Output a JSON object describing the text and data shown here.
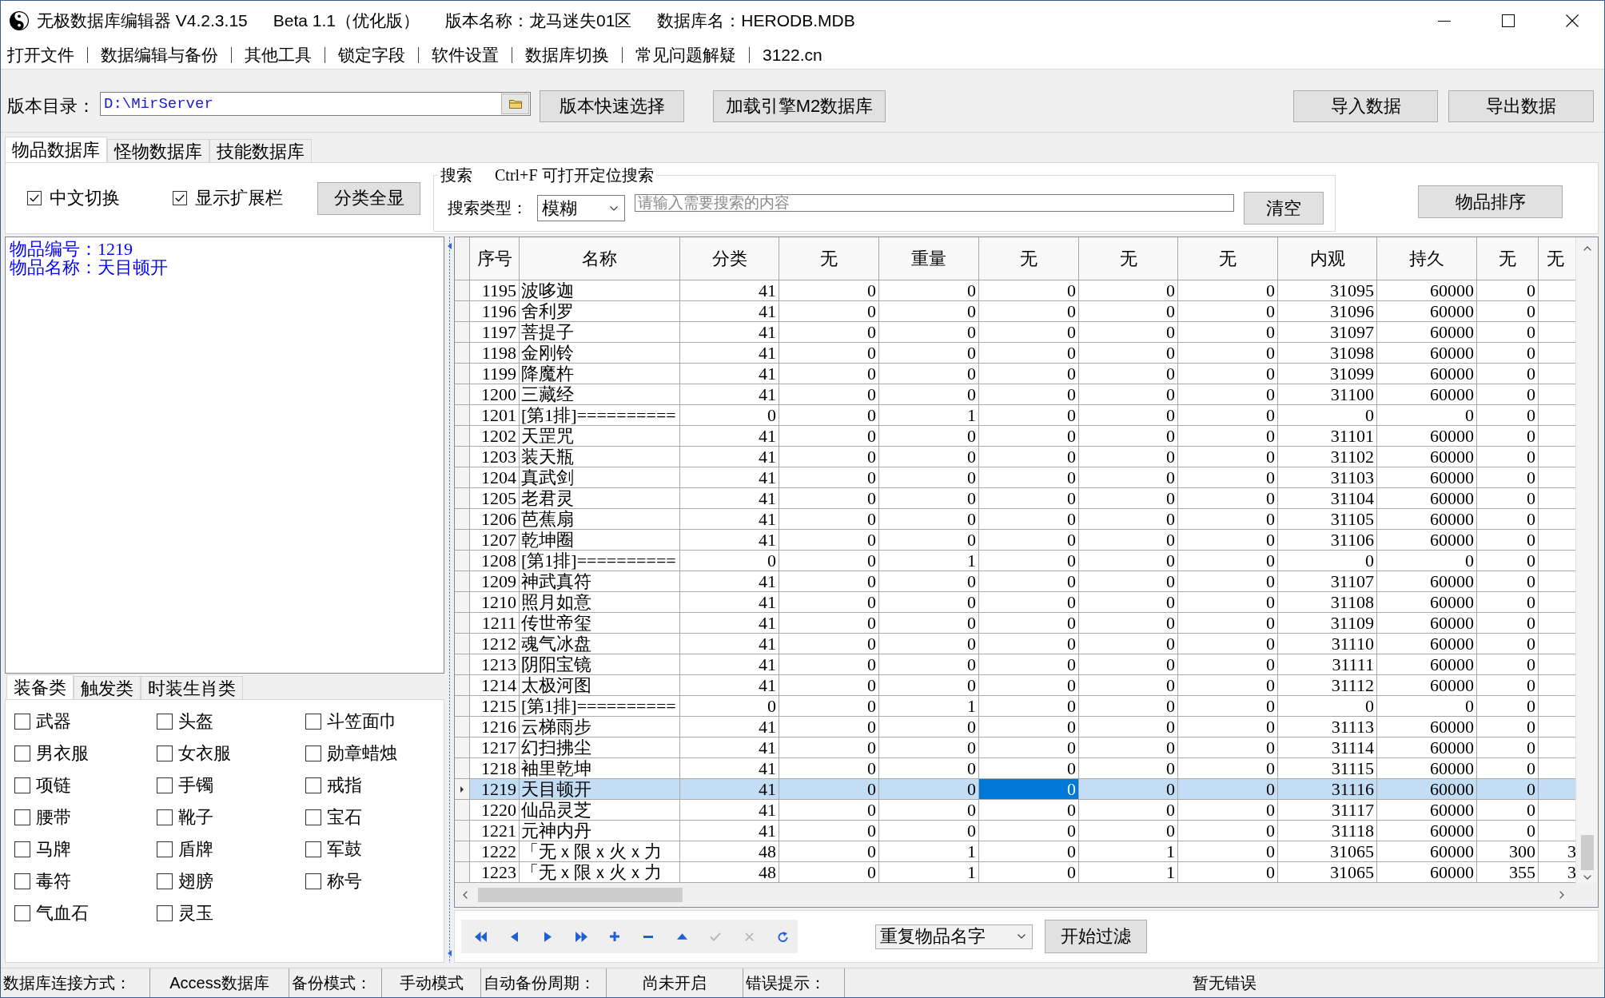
{
  "window": {
    "title_segments": [
      "无极数据库编辑器 V4.2.3.15",
      "Beta 1.1（优化版）",
      "版本名称：龙马迷失01区",
      "数据库名：HERODB.MDB"
    ]
  },
  "menu": [
    "打开文件",
    "数据编辑与备份",
    "其他工具",
    "锁定字段",
    "软件设置",
    "数据库切换",
    "常见问题解疑",
    "3122.cn"
  ],
  "toolbar": {
    "path_label": "版本目录：",
    "path_value": "D:\\MirServer",
    "buttons": [
      "版本快速选择",
      "加载引擎M2数据库"
    ],
    "right_buttons": [
      "导入数据",
      "导出数据"
    ]
  },
  "tabs": [
    {
      "label": "物品数据库",
      "selected": true
    },
    {
      "label": "怪物数据库",
      "selected": false
    },
    {
      "label": "技能数据库",
      "selected": false
    }
  ],
  "options": {
    "checkboxes": [
      {
        "label": "中文切换",
        "checked": true
      },
      {
        "label": "显示扩展栏",
        "checked": true
      }
    ],
    "show_all_button": "分类全显",
    "search": {
      "title": "搜索",
      "hint": "Ctrl+F 可打开定位搜索",
      "type_label": "搜索类型：",
      "type_value": "模糊",
      "placeholder": "请输入需要搜索的内容",
      "clear_button": "清空"
    },
    "sort_button": "物品排序"
  },
  "details": {
    "lines": [
      "物品编号：1219",
      "物品名称：天目顿开"
    ]
  },
  "category_tabs": [
    {
      "label": "装备类",
      "selected": true
    },
    {
      "label": "触发类",
      "selected": false
    },
    {
      "label": "时装生肖类",
      "selected": false
    }
  ],
  "categories": [
    {
      "label": "武器",
      "checked": false
    },
    {
      "label": "头盔",
      "checked": false
    },
    {
      "label": "斗笠面巾",
      "checked": false
    },
    {
      "label": "男衣服",
      "checked": false
    },
    {
      "label": "女衣服",
      "checked": false
    },
    {
      "label": "勋章蜡烛",
      "checked": false
    },
    {
      "label": "项链",
      "checked": false
    },
    {
      "label": "手镯",
      "checked": false
    },
    {
      "label": "戒指",
      "checked": false
    },
    {
      "label": "腰带",
      "checked": false
    },
    {
      "label": "靴子",
      "checked": false
    },
    {
      "label": "宝石",
      "checked": false
    },
    {
      "label": "马牌",
      "checked": false
    },
    {
      "label": "盾牌",
      "checked": false
    },
    {
      "label": "军鼓",
      "checked": false
    },
    {
      "label": "毒符",
      "checked": false
    },
    {
      "label": "翅膀",
      "checked": false
    },
    {
      "label": "称号",
      "checked": false
    },
    {
      "label": "气血石",
      "checked": false
    },
    {
      "label": "灵玉",
      "checked": false
    }
  ],
  "table": {
    "columns": [
      "序号",
      "名称",
      "分类",
      "无",
      "重量",
      "无",
      "无",
      "无",
      "内观",
      "持久",
      "无",
      "无"
    ],
    "rows": [
      {
        "cells": [
          "1195",
          "波哆迦",
          "41",
          "0",
          "0",
          "0",
          "0",
          "0",
          "31095",
          "60000",
          "0"
        ],
        "selected": false
      },
      {
        "cells": [
          "1196",
          "舍利罗",
          "41",
          "0",
          "0",
          "0",
          "0",
          "0",
          "31096",
          "60000",
          "0"
        ],
        "selected": false
      },
      {
        "cells": [
          "1197",
          "菩提子",
          "41",
          "0",
          "0",
          "0",
          "0",
          "0",
          "31097",
          "60000",
          "0"
        ],
        "selected": false
      },
      {
        "cells": [
          "1198",
          "金刚铃",
          "41",
          "0",
          "0",
          "0",
          "0",
          "0",
          "31098",
          "60000",
          "0"
        ],
        "selected": false
      },
      {
        "cells": [
          "1199",
          "降魔杵",
          "41",
          "0",
          "0",
          "0",
          "0",
          "0",
          "31099",
          "60000",
          "0"
        ],
        "selected": false
      },
      {
        "cells": [
          "1200",
          "三藏经",
          "41",
          "0",
          "0",
          "0",
          "0",
          "0",
          "31100",
          "60000",
          "0"
        ],
        "selected": false
      },
      {
        "cells": [
          "1201",
          "[第1排]==========",
          "0",
          "0",
          "1",
          "0",
          "0",
          "0",
          "0",
          "0",
          "0"
        ],
        "selected": false
      },
      {
        "cells": [
          "1202",
          "天罡咒",
          "41",
          "0",
          "0",
          "0",
          "0",
          "0",
          "31101",
          "60000",
          "0"
        ],
        "selected": false
      },
      {
        "cells": [
          "1203",
          "装天瓶",
          "41",
          "0",
          "0",
          "0",
          "0",
          "0",
          "31102",
          "60000",
          "0"
        ],
        "selected": false
      },
      {
        "cells": [
          "1204",
          "真武剑",
          "41",
          "0",
          "0",
          "0",
          "0",
          "0",
          "31103",
          "60000",
          "0"
        ],
        "selected": false
      },
      {
        "cells": [
          "1205",
          "老君灵",
          "41",
          "0",
          "0",
          "0",
          "0",
          "0",
          "31104",
          "60000",
          "0"
        ],
        "selected": false
      },
      {
        "cells": [
          "1206",
          "芭蕉扇",
          "41",
          "0",
          "0",
          "0",
          "0",
          "0",
          "31105",
          "60000",
          "0"
        ],
        "selected": false
      },
      {
        "cells": [
          "1207",
          "乾坤圈",
          "41",
          "0",
          "0",
          "0",
          "0",
          "0",
          "31106",
          "60000",
          "0"
        ],
        "selected": false
      },
      {
        "cells": [
          "1208",
          "[第1排]==========",
          "0",
          "0",
          "1",
          "0",
          "0",
          "0",
          "0",
          "0",
          "0"
        ],
        "selected": false
      },
      {
        "cells": [
          "1209",
          "神武真符",
          "41",
          "0",
          "0",
          "0",
          "0",
          "0",
          "31107",
          "60000",
          "0"
        ],
        "selected": false
      },
      {
        "cells": [
          "1210",
          "照月如意",
          "41",
          "0",
          "0",
          "0",
          "0",
          "0",
          "31108",
          "60000",
          "0"
        ],
        "selected": false
      },
      {
        "cells": [
          "1211",
          "传世帝玺",
          "41",
          "0",
          "0",
          "0",
          "0",
          "0",
          "31109",
          "60000",
          "0"
        ],
        "selected": false
      },
      {
        "cells": [
          "1212",
          "魂气冰盘",
          "41",
          "0",
          "0",
          "0",
          "0",
          "0",
          "31110",
          "60000",
          "0"
        ],
        "selected": false
      },
      {
        "cells": [
          "1213",
          "阴阳宝镜",
          "41",
          "0",
          "0",
          "0",
          "0",
          "0",
          "31111",
          "60000",
          "0"
        ],
        "selected": false
      },
      {
        "cells": [
          "1214",
          "太极河图",
          "41",
          "0",
          "0",
          "0",
          "0",
          "0",
          "31112",
          "60000",
          "0"
        ],
        "selected": false
      },
      {
        "cells": [
          "1215",
          "[第1排]==========",
          "0",
          "0",
          "1",
          "0",
          "0",
          "0",
          "0",
          "0",
          "0"
        ],
        "selected": false
      },
      {
        "cells": [
          "1216",
          "云梯雨步",
          "41",
          "0",
          "0",
          "0",
          "0",
          "0",
          "31113",
          "60000",
          "0"
        ],
        "selected": false
      },
      {
        "cells": [
          "1217",
          "幻扫拂尘",
          "41",
          "0",
          "0",
          "0",
          "0",
          "0",
          "31114",
          "60000",
          "0"
        ],
        "selected": false
      },
      {
        "cells": [
          "1218",
          "袖里乾坤",
          "41",
          "0",
          "0",
          "0",
          "0",
          "0",
          "31115",
          "60000",
          "0"
        ],
        "selected": false
      },
      {
        "cells": [
          {
            "text": "1219",
            "focused": false
          },
          {
            "text": "天目顿开",
            "focused": false
          },
          {
            "text": "41",
            "focused": false
          },
          {
            "text": "0",
            "focused": false
          },
          {
            "text": "0",
            "focused": false
          },
          {
            "text": "0",
            "focused": true
          },
          {
            "text": "0",
            "focused": false
          },
          {
            "text": "0",
            "focused": false
          },
          {
            "text": "31116",
            "focused": false
          },
          {
            "text": "60000",
            "focused": false
          },
          {
            "text": "0",
            "focused": false
          }
        ],
        "selected": true
      },
      {
        "cells": [
          "1220",
          "仙品灵芝",
          "41",
          "0",
          "0",
          "0",
          "0",
          "0",
          "31117",
          "60000",
          "0"
        ],
        "selected": false
      },
      {
        "cells": [
          "1221",
          "元神内丹",
          "41",
          "0",
          "0",
          "0",
          "0",
          "0",
          "31118",
          "60000",
          "0"
        ],
        "selected": false
      },
      {
        "cells": [
          "1222",
          "「无ｘ限ｘ火ｘ力",
          "48",
          "0",
          "1",
          "0",
          "1",
          "0",
          "31065",
          "60000",
          "300",
          "3"
        ],
        "selected": false
      },
      {
        "cells": [
          "1223",
          "「无ｘ限ｘ火ｘ力",
          "48",
          "0",
          "1",
          "0",
          "1",
          "0",
          "31065",
          "60000",
          "355",
          "3"
        ],
        "selected": false
      }
    ]
  },
  "navigator": [
    {
      "kind": "first",
      "disabled": false
    },
    {
      "kind": "prior",
      "disabled": false
    },
    {
      "kind": "next",
      "disabled": false
    },
    {
      "kind": "last",
      "disabled": false
    },
    {
      "kind": "insert",
      "disabled": false
    },
    {
      "kind": "delete",
      "disabled": false
    },
    {
      "kind": "edit",
      "disabled": false
    },
    {
      "kind": "post",
      "disabled": true
    },
    {
      "kind": "cancel",
      "disabled": true
    },
    {
      "kind": "refresh",
      "disabled": false
    }
  ],
  "filter": {
    "value": "重复物品名字",
    "button": "开始过滤"
  },
  "status_bar": [
    {
      "label": "数据库连接方式：",
      "value": "Access数据库"
    },
    {
      "label": "备份模式：",
      "value": "手动模式"
    },
    {
      "label": "自动备份周期：",
      "value": "尚未开启"
    },
    {
      "label": "错误提示：",
      "value": "暂无错误"
    }
  ]
}
